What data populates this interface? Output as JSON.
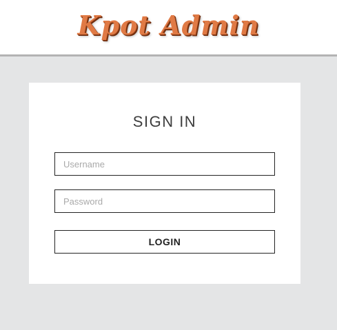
{
  "header": {
    "logo_text": "Kpot Admin"
  },
  "login_form": {
    "title": "SIGN IN",
    "username_placeholder": "Username",
    "username_value": "",
    "password_placeholder": "Password",
    "password_value": "",
    "login_label": "LOGIN"
  },
  "colors": {
    "page_background": "#e4e5e6",
    "logo_accent": "#e07a45",
    "card_background": "#ffffff",
    "border": "#222222"
  }
}
